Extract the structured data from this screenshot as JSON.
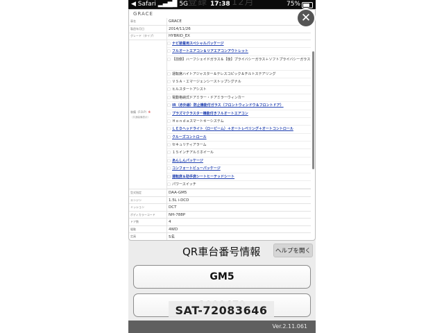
{
  "status_bar": {
    "carrier": "◀ Safari",
    "signal": "▂▄▆█ 5G",
    "time": "17:38",
    "background_text": "登録 H　 12月",
    "battery": "75%"
  },
  "sheet": {
    "title": "GRACE",
    "rows_top": [
      {
        "key": "車名",
        "value": "GRACE"
      },
      {
        "key": "製造年月日",
        "value": "2014/11/26"
      },
      {
        "key": "グレード（タイプ）",
        "value": "HYBRID_EX"
      }
    ],
    "options_key": "装備（F.O.P）",
    "options_key_mark": "※",
    "options_key_sub": "（共通装備表示）",
    "options": [
      {
        "text": "ナビ装着用スペシャルパッケージ",
        "link": true,
        "tall": false
      },
      {
        "text": "フルオートエアコン＆リアエアコンアウトレット",
        "link": true,
        "tall": false
      },
      {
        "text": "【前側】ハーフシェイドガラス＆【後】プライバシーガラス＋ソフトプライバシーガラス",
        "link": false,
        "tall": true
      },
      {
        "text": "運転席ハイトアジャスター＆テレスコピック＆チルトステアリング",
        "link": false,
        "tall": false
      },
      {
        "text": "ＶＳＡ・エマージェンシーストップシグナル",
        "link": false,
        "tall": false
      },
      {
        "text": "ヒルスタートアシスト",
        "link": false,
        "tall": false
      },
      {
        "text": "電動格納式ドアミラー・ドアミラーウィンカー",
        "link": false,
        "tall": false
      },
      {
        "text": "IR（赤外線）防止機能付ガラス（フロントウィンドウ＆フロントドア）",
        "link": true,
        "tall": false
      },
      {
        "text": "プラズマクラスター機能付きフルオートエアコン",
        "link": true,
        "tall": false
      },
      {
        "text": "Ｈｏｎｄａスマートキーシステム",
        "link": false,
        "tall": false
      },
      {
        "text": "ＬＥＤヘッドライト（ロービーム）＋オートレベリング＋オートコントロール",
        "link": true,
        "tall": false
      },
      {
        "text": "クルーズコントロール",
        "link": true,
        "tall": false
      },
      {
        "text": "セキュリティアラーム",
        "link": false,
        "tall": false
      },
      {
        "text": "１５インチアルミホイール",
        "link": false,
        "tall": false
      },
      {
        "text": "あんしんパッケージ",
        "link": true,
        "tall": false
      },
      {
        "text": "コンフォートビューパッケージ",
        "link": true,
        "tall": false
      },
      {
        "text": "運転席＆助手席シートヒーテッドシート",
        "link": true,
        "tall": false
      },
      {
        "text": "パワースイッチ",
        "link": false,
        "tall": false
      }
    ],
    "rows_bottom": [
      {
        "key": "型式指定",
        "value": "DAA-GM5"
      },
      {
        "key": "エンジン",
        "value": "1.5L i-DCD"
      },
      {
        "key": "ミッション",
        "value": "DCT"
      },
      {
        "key": "ボディカラーコード",
        "value": "NH-788P"
      },
      {
        "key": "ドア数",
        "value": "4"
      },
      {
        "key": "駆動",
        "value": "4WD"
      },
      {
        "key": "定員",
        "value": "5名"
      }
    ]
  },
  "qr": {
    "label": "QR車台番号情報",
    "help_button": "ヘルプを開く",
    "field1": "GM5",
    "field2": "1000479"
  },
  "overlay_text": "SAT-72083646",
  "version": "Ver.2.11.061",
  "colors": {
    "link": "#1f3fb0",
    "accent_red": "#c00000",
    "bottom_bar": "#5f5f5f"
  }
}
